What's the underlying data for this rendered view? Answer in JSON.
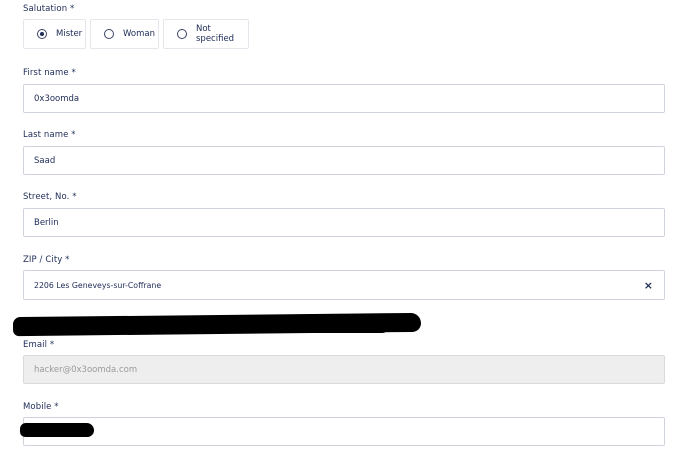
{
  "salutation": {
    "label": "Salutation *",
    "options": [
      {
        "label": "Mister",
        "checked": true
      },
      {
        "label": "Woman",
        "checked": false
      },
      {
        "label": "Not specified",
        "checked": false
      }
    ]
  },
  "first_name": {
    "label": "First name *",
    "value": "0x3oomda"
  },
  "last_name": {
    "label": "Last name *",
    "value": "Saad"
  },
  "street": {
    "label": "Street, No. *",
    "value": "Berlin"
  },
  "zip_city": {
    "label": "ZIP / City *",
    "value": "2206 Les Geneveys-sur-Coffrane",
    "clear_symbol": "×"
  },
  "email": {
    "label": "Email *",
    "value": "hacker@0x3oomda.com"
  },
  "mobile": {
    "label": "Mobile *",
    "value": ""
  }
}
